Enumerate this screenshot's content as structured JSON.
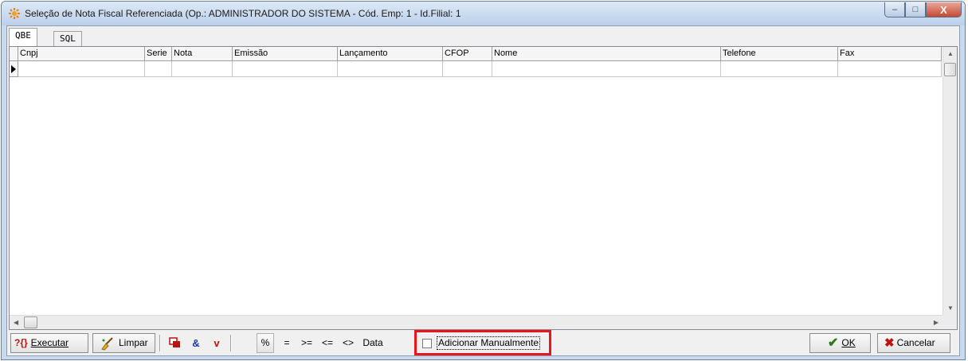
{
  "window": {
    "title": "Seleção de Nota Fiscal Referenciada (Op.: ADMINISTRADOR DO SISTEMA - Cód. Emp: 1 - Id.Filial: 1",
    "minimize": "–",
    "maximize": "□",
    "close": "X"
  },
  "tabs": [
    "QBE",
    "SQL"
  ],
  "grid": {
    "columns": [
      "Cnpj",
      "Serie",
      "Nota",
      "Emissão",
      "Lançamento",
      "CFOP",
      "Nome",
      "Telefone",
      "Fax"
    ]
  },
  "scroll": {
    "up": "▲",
    "down": "▼",
    "left": "◀",
    "right": "▶"
  },
  "toolbar": {
    "executar_icon": "?{}",
    "executar": "Executar",
    "limpar": "Limpar",
    "op_percent": "%",
    "op_eq": "=",
    "op_gte": ">=",
    "op_lte": "<=",
    "op_ne": "<>",
    "data": "Data",
    "adicionar": "Adicionar Manualmente",
    "ok": "OK",
    "cancelar": "Cancelar"
  },
  "colors": {
    "highlight": "#e8151a",
    "ok_check": "#2a7a1a",
    "cancel_x": "#c01010"
  }
}
